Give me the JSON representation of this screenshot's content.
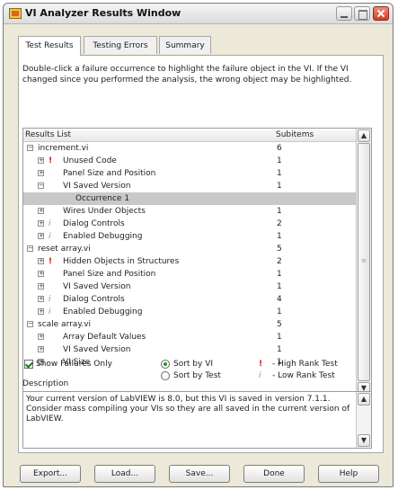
{
  "window": {
    "title": "VI Analyzer Results Window"
  },
  "tabs": [
    {
      "label": "Test Results",
      "active": true
    },
    {
      "label": "Testing Errors",
      "active": false
    },
    {
      "label": "Summary",
      "active": false
    }
  ],
  "instructions": "Double-click a failure occurrence to highlight the failure object in the VI.  If the VI changed since you performed the analysis, the wrong object may be highlighted.",
  "results_list": {
    "header_label": "Results List",
    "header_subitems": "Subitems",
    "rows": [
      {
        "level": 0,
        "expander": "−",
        "marker": "",
        "text": "increment.vi",
        "count": "6",
        "selected": false
      },
      {
        "level": 1,
        "expander": "+",
        "marker": "!",
        "text": "Unused Code",
        "count": "1",
        "selected": false
      },
      {
        "level": 1,
        "expander": "+",
        "marker": "",
        "text": "Panel Size and Position",
        "count": "1",
        "selected": false
      },
      {
        "level": 1,
        "expander": "−",
        "marker": "",
        "text": "VI Saved Version",
        "count": "1",
        "selected": false
      },
      {
        "level": 2,
        "expander": "",
        "marker": "",
        "text": "Occurrence 1",
        "count": "",
        "selected": true
      },
      {
        "level": 1,
        "expander": "+",
        "marker": "",
        "text": "Wires Under Objects",
        "count": "1",
        "selected": false
      },
      {
        "level": 1,
        "expander": "+",
        "marker": "i",
        "text": "Dialog Controls",
        "count": "2",
        "selected": false
      },
      {
        "level": 1,
        "expander": "+",
        "marker": "i",
        "text": "Enabled Debugging",
        "count": "1",
        "selected": false
      },
      {
        "level": 0,
        "expander": "−",
        "marker": "",
        "text": "reset array.vi",
        "count": "5",
        "selected": false
      },
      {
        "level": 1,
        "expander": "+",
        "marker": "!",
        "text": "Hidden Objects in Structures",
        "count": "2",
        "selected": false
      },
      {
        "level": 1,
        "expander": "+",
        "marker": "",
        "text": "Panel Size and Position",
        "count": "1",
        "selected": false
      },
      {
        "level": 1,
        "expander": "+",
        "marker": "",
        "text": "VI Saved Version",
        "count": "1",
        "selected": false
      },
      {
        "level": 1,
        "expander": "+",
        "marker": "i",
        "text": "Dialog Controls",
        "count": "4",
        "selected": false
      },
      {
        "level": 1,
        "expander": "+",
        "marker": "i",
        "text": "Enabled Debugging",
        "count": "1",
        "selected": false
      },
      {
        "level": 0,
        "expander": "−",
        "marker": "",
        "text": "scale array.vi",
        "count": "5",
        "selected": false
      },
      {
        "level": 1,
        "expander": "+",
        "marker": "",
        "text": "Array Default Values",
        "count": "1",
        "selected": false
      },
      {
        "level": 1,
        "expander": "+",
        "marker": "",
        "text": "VI Saved Version",
        "count": "1",
        "selected": false
      },
      {
        "level": 1,
        "expander": "+",
        "marker": "",
        "text": "VI Size",
        "count": "1",
        "selected": false
      }
    ]
  },
  "options": {
    "show_failures_only": "Show Failures Only",
    "show_failures_checked": true,
    "sort_by_vi": "Sort by VI",
    "sort_by_test": "Sort by Test",
    "sort_selected": "Sort by VI",
    "legend_high_symbol": "!",
    "legend_high": "- High Rank Test",
    "legend_low_symbol": "i",
    "legend_low": "- Low Rank Test"
  },
  "description": {
    "label": "Description",
    "text": "Your current version of LabVIEW is 8.0, but this VI is saved in version 7.1.1. Consider mass compiling your VIs so they are all saved in the current version of LabVIEW."
  },
  "buttons": {
    "export": "Export...",
    "load": "Load...",
    "save": "Save...",
    "done": "Done",
    "help": "Help"
  },
  "colors": {
    "high_rank": "#d41a0f",
    "low_rank": "#8c8c8c",
    "selection": "#c8c8c8"
  }
}
